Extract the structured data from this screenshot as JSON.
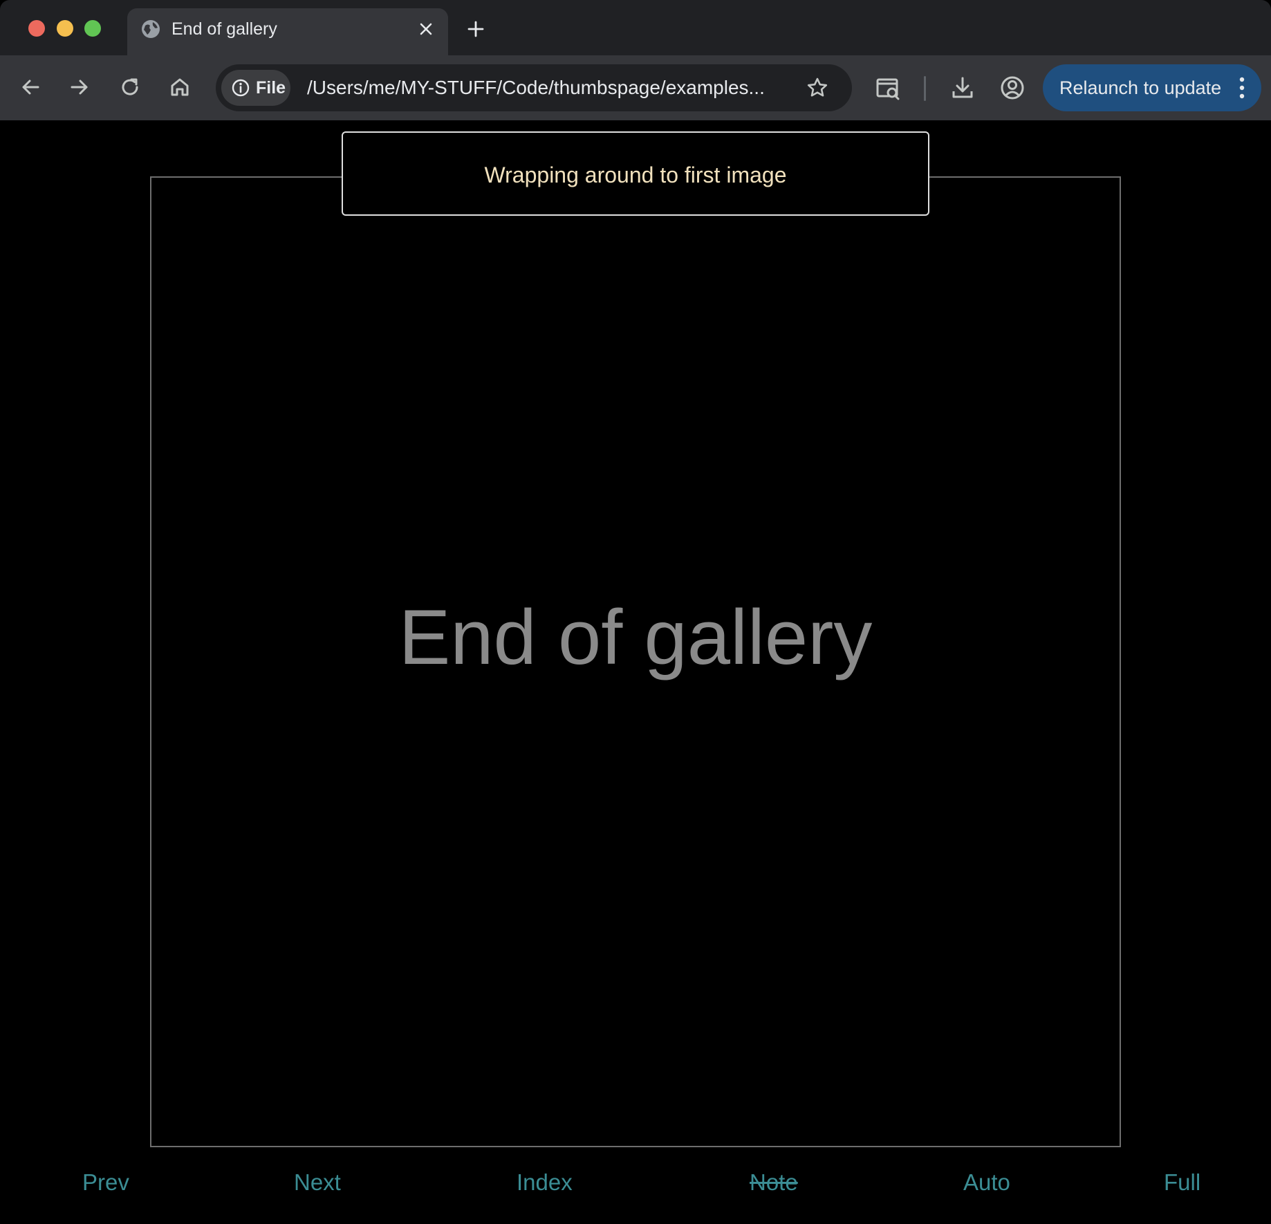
{
  "browser": {
    "tab": {
      "title": "End of gallery"
    },
    "omnibox": {
      "chip_label": "File",
      "url": "/Users/me/MY-STUFF/Code/thumbspage/examples..."
    },
    "relaunch_label": "Relaunch to update"
  },
  "page": {
    "toast": "Wrapping around to first image",
    "gallery_text": "End of gallery",
    "nav": {
      "prev": "Prev",
      "next": "Next",
      "index": "Index",
      "note": "Note",
      "auto": "Auto",
      "full": "Full"
    }
  },
  "colors": {
    "link": "#3b8d94",
    "toast_text": "#f1e1bd",
    "relaunch_bg": "#1f4f7f"
  }
}
